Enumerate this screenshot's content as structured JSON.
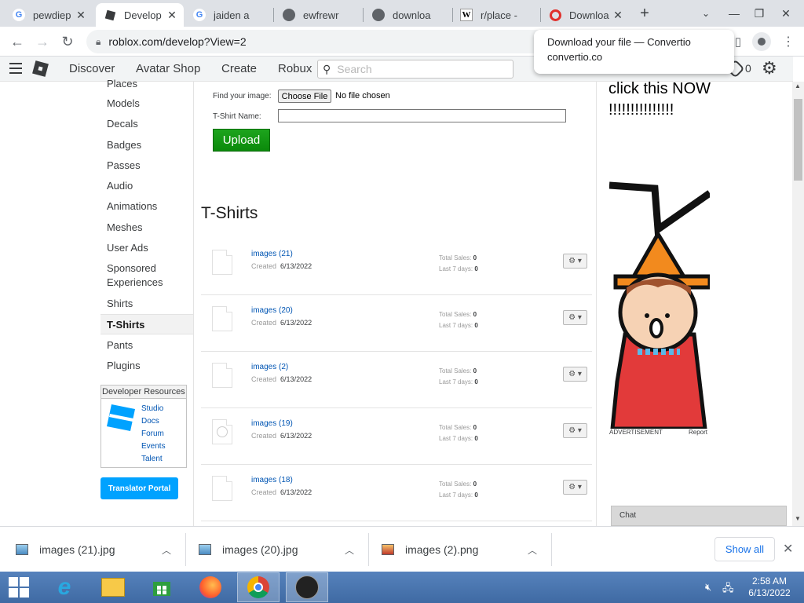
{
  "browser": {
    "tabs": [
      {
        "label": "pewdiep",
        "icon": "google-icon"
      },
      {
        "label": "Develop",
        "icon": "roblox-icon",
        "active": true
      },
      {
        "label": "jaiden a",
        "icon": "google-icon"
      },
      {
        "label": "ewfrewr",
        "icon": "globe-icon"
      },
      {
        "label": "downloa",
        "icon": "globe-icon"
      },
      {
        "label": "r/place -",
        "icon": "wikipedia-icon"
      },
      {
        "label": "Downloa",
        "icon": "convertio-icon"
      }
    ],
    "url": "roblox.com/develop?View=2",
    "notification": {
      "title": "Download your file — Convertio",
      "source": "convertio.co"
    }
  },
  "header": {
    "nav": [
      "Discover",
      "Avatar Shop",
      "Create",
      "Robux"
    ],
    "search_placeholder": "Search",
    "robux_count": "0"
  },
  "sidebar": {
    "items": [
      "Places",
      "Models",
      "Decals",
      "Badges",
      "Passes",
      "Audio",
      "Animations",
      "Meshes",
      "User Ads",
      "Sponsored Experiences",
      "Shirts",
      "T-Shirts",
      "Pants",
      "Plugins"
    ],
    "active_item": "T-Shirts",
    "dev_resources": {
      "title": "Developer Resources",
      "links": [
        "Studio",
        "Docs",
        "Forum",
        "Events",
        "Talent"
      ]
    },
    "translator_label": "Translator Portal"
  },
  "upload": {
    "find_label": "Find your image:",
    "choose_label": "Choose File",
    "no_file": "No file chosen",
    "name_label": "T-Shirt Name:",
    "upload_label": "Upload"
  },
  "section_title": "T-Shirts",
  "items": [
    {
      "name": "images (21)",
      "created_label": "Created",
      "created": "6/13/2022",
      "total_label": "Total Sales:",
      "total": "0",
      "last_label": "Last 7 days:",
      "last7": "0"
    },
    {
      "name": "images (20)",
      "created_label": "Created",
      "created": "6/13/2022",
      "total_label": "Total Sales:",
      "total": "0",
      "last_label": "Last 7 days:",
      "last7": "0"
    },
    {
      "name": "images (2)",
      "created_label": "Created",
      "created": "6/13/2022",
      "total_label": "Total Sales:",
      "total": "0",
      "last_label": "Last 7 days:",
      "last7": "0"
    },
    {
      "name": "images (19)",
      "created_label": "Created",
      "created": "6/13/2022",
      "total_label": "Total Sales:",
      "total": "0",
      "last_label": "Last 7 days:",
      "last7": "0"
    },
    {
      "name": "images (18)",
      "created_label": "Created",
      "created": "6/13/2022",
      "total_label": "Total Sales:",
      "total": "0",
      "last_label": "Last 7 days:",
      "last7": "0"
    }
  ],
  "ad": {
    "text_line1": "click this NOW",
    "text_line2": "!!!!!!!!!!!!!!!",
    "label": "ADVERTISEMENT",
    "report": "Report"
  },
  "chat_label": "Chat",
  "downloads": {
    "files": [
      "images (21).jpg",
      "images (20).jpg",
      "images (2).png"
    ],
    "show_all": "Show all"
  },
  "taskbar": {
    "time": "2:58 AM",
    "date": "6/13/2022"
  }
}
